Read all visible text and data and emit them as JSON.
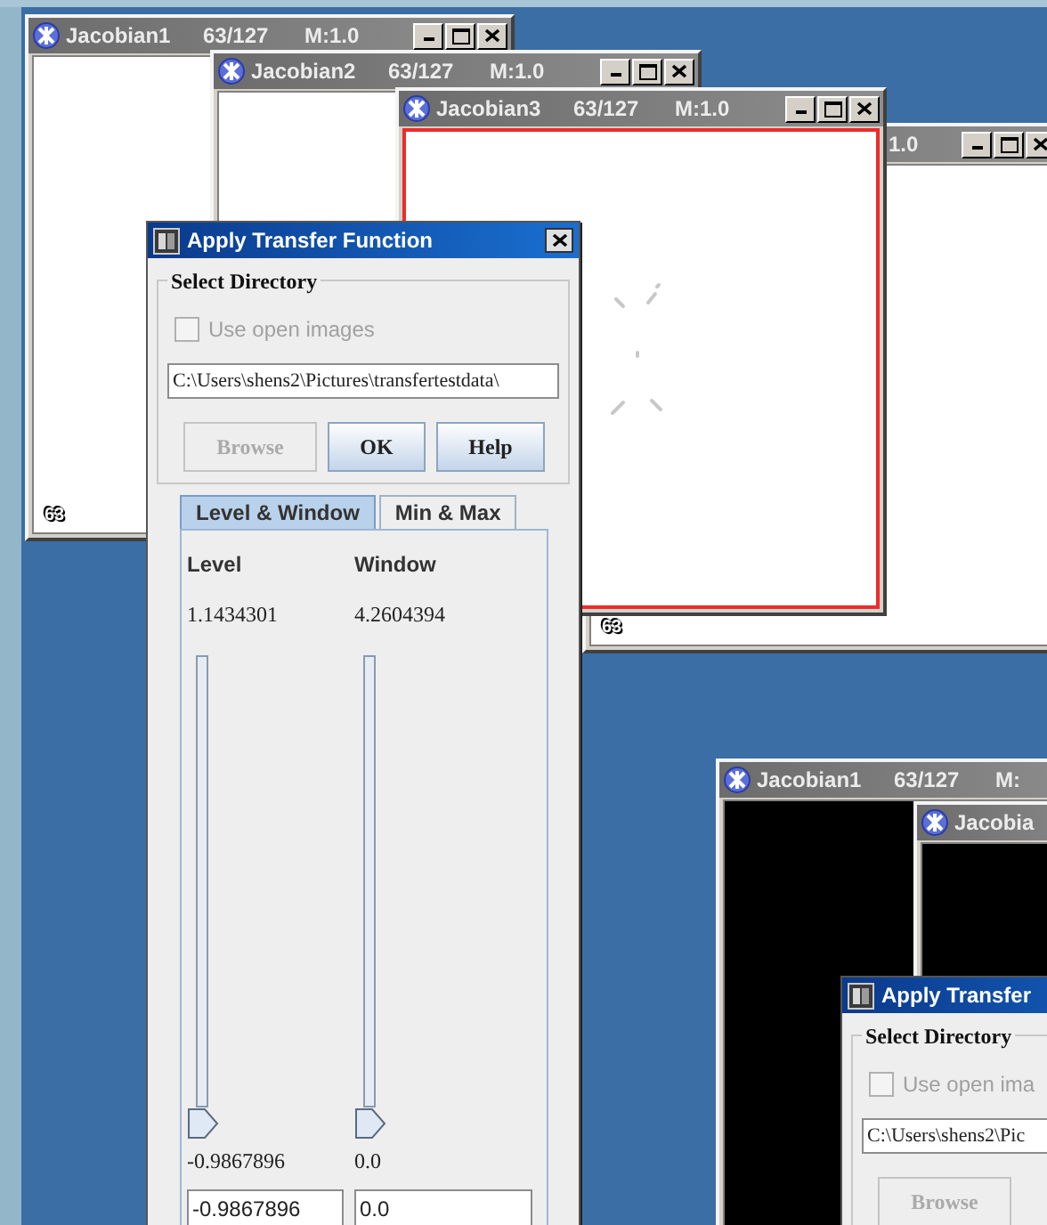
{
  "desktop": {
    "image_windows": [
      {
        "kind": "light",
        "title": "Jacobian1",
        "slice": "63/127",
        "zoom": "M:1.0",
        "selected": false,
        "label": "63"
      },
      {
        "kind": "light",
        "title": "Jacobian2",
        "slice": "63/127",
        "zoom": "M:1.0",
        "selected": false
      },
      {
        "kind": "light",
        "title": "Jacobian3",
        "slice": "63/127",
        "zoom": "M:1.0",
        "selected": true
      },
      {
        "kind": "light",
        "zoom": "1.0",
        "selected": false,
        "label": "63"
      },
      {
        "kind": "dark",
        "title": "Jacobian1",
        "slice": "63/127",
        "zoom": "M:",
        "selected": false
      },
      {
        "kind": "dark",
        "title": "Jacobia",
        "selected": false
      }
    ],
    "dialogs": [
      {
        "title": "Apply Transfer Function",
        "group_title": "Select Directory",
        "checkbox": {
          "label": "Use open images",
          "checked": false,
          "disabled": true
        },
        "directory": "C:\\Users\\shens2\\Pictures\\transfertestdata\\",
        "buttons": [
          {
            "label": "Browse",
            "disabled": true
          },
          {
            "label": "OK",
            "disabled": false
          },
          {
            "label": "Help",
            "disabled": false
          }
        ],
        "tabs": [
          {
            "label": "Level & Window",
            "selected": true
          },
          {
            "label": "Min & Max",
            "selected": false
          }
        ],
        "sliders": [
          {
            "name": "Level",
            "value": "1.1434301",
            "level": 0,
            "min_reading": "-0.9867896",
            "field": "-0.9867896"
          },
          {
            "name": "Window",
            "value": "4.2604394",
            "level": 0,
            "min_reading": "0.0",
            "field": "0.0"
          }
        ]
      },
      {
        "title": "Apply Transfer",
        "group_title": "Select Directory",
        "checkbox": {
          "label": "Use open ima",
          "checked": false,
          "disabled": true
        },
        "directory": "C:\\Users\\shens2\\Pic",
        "buttons": [
          {
            "label": "Browse",
            "disabled": true
          }
        ]
      }
    ]
  }
}
